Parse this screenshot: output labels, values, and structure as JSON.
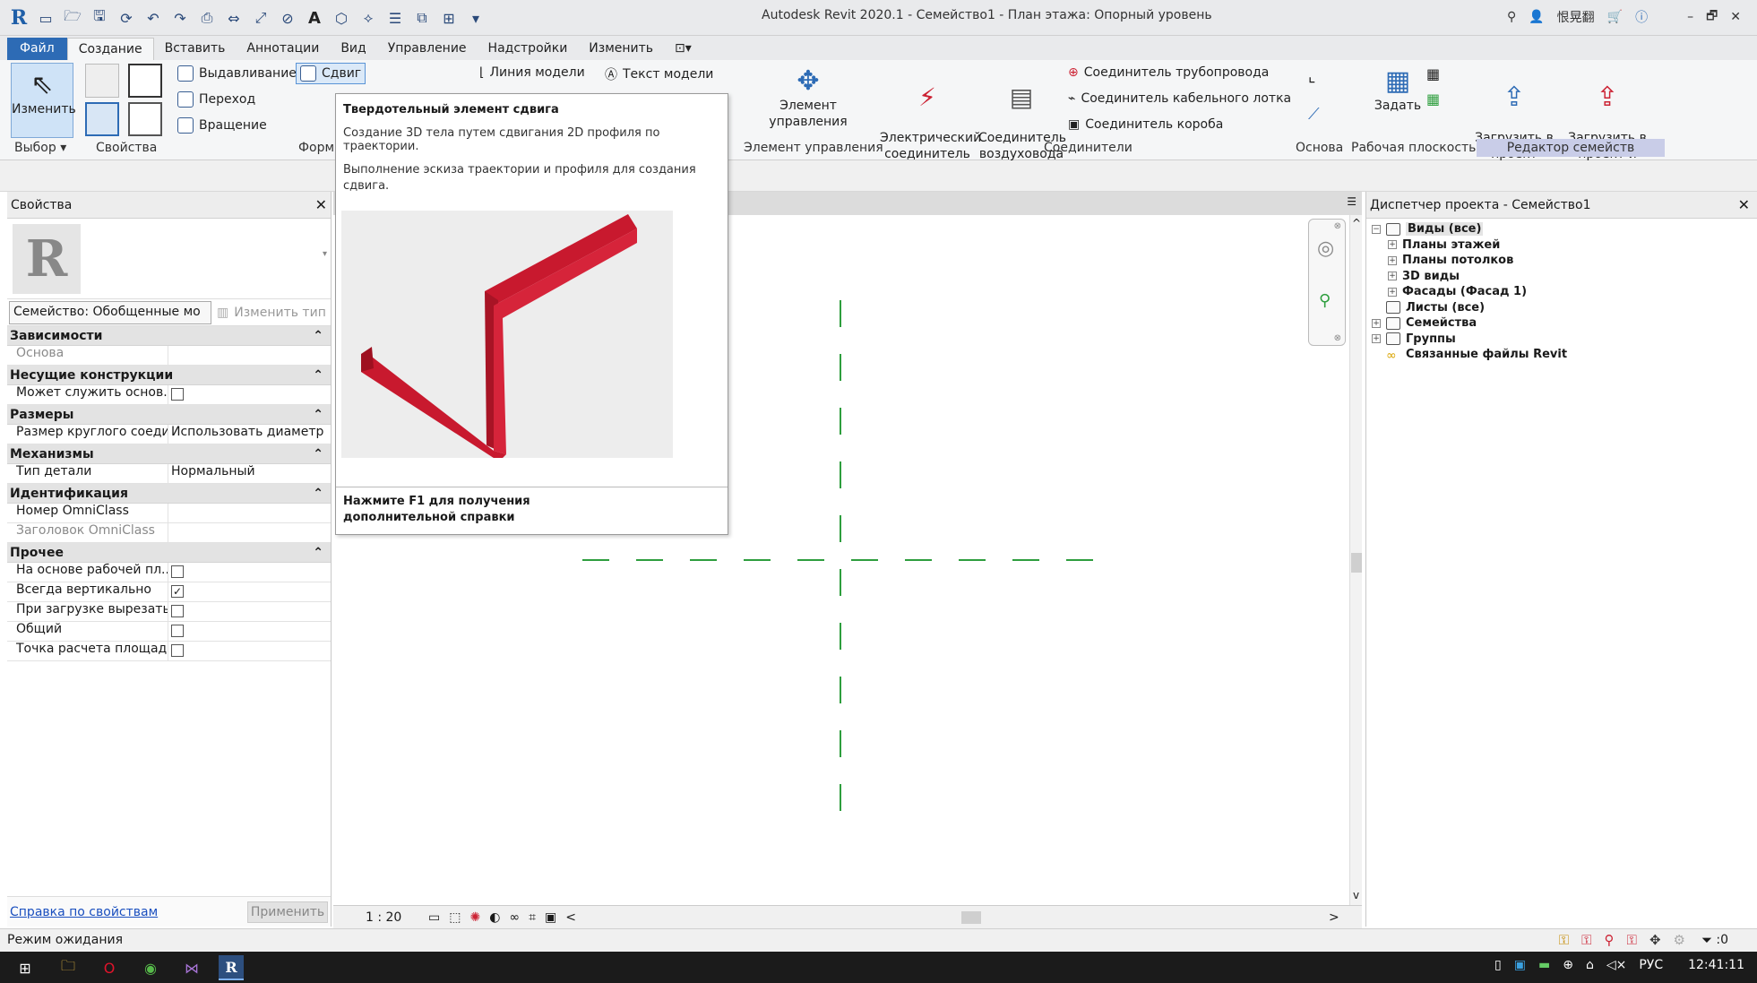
{
  "window": {
    "title": "Autodesk Revit 2020.1 - Семейство1 - План этажа: Опорный уровень",
    "user": "恨晃翻",
    "controls": {
      "minimize": "–",
      "restore": "🗗",
      "close": "✕"
    }
  },
  "tabs": {
    "file": "Файл",
    "items": [
      "Создание",
      "Вставить",
      "Аннотации",
      "Вид",
      "Управление",
      "Надстройки",
      "Изменить"
    ]
  },
  "ribbon": {
    "modify_label": "Изменить",
    "select_panel": "Выбор ▾",
    "properties_panel": "Свойства",
    "forms_panel": "Форм",
    "extrusion": "Выдавливание",
    "sweep": "Сдвиг",
    "blend": "Переход",
    "revolve": "Вращение",
    "model_line": "Линия модели",
    "model_text": "Текст модели",
    "control_element": "Элемент управления",
    "control_panel": "Элемент управления",
    "electrical_connector": "Электрический\nсоединитель",
    "duct_connector": "Соединитель\nвоздуховода",
    "pipe_connector": "Соединитель трубопровода",
    "cable_tray_connector": "Соединитель кабельного лотка",
    "conduit_connector": "Соединитель короба",
    "connectors_panel": "Соединители",
    "datum_panel": "Основа",
    "set": "Задать",
    "workplane_panel": "Рабочая плоскость",
    "load_into_project": "Загрузить в\nпроект",
    "load_and_close": "Загрузить в\nпроект и закрыть",
    "family_editor_panel": "Редактор семейств"
  },
  "tooltip": {
    "title": "Твердотельный элемент сдвига",
    "description": "Создание 3D тела путем сдвигания 2D профиля по траектории.",
    "hint": "Выполнение эскиза траектории и профиля для создания сдвига.",
    "f1": "Нажмите F1 для получения дополнительной справки"
  },
  "properties": {
    "title": "Свойства",
    "type_selector": "Семейство: Обобщенные мо",
    "edit_type": "Изменить тип",
    "groups": [
      {
        "name": "Зависимости",
        "rows": [
          {
            "k": "Основа",
            "v": "",
            "dim": true
          }
        ]
      },
      {
        "name": "Несущие конструкции",
        "rows": [
          {
            "k": "Может служить основ...",
            "v": "",
            "cb": "empty-box"
          }
        ]
      },
      {
        "name": "Размеры",
        "rows": [
          {
            "k": "Размер круглого соеди...",
            "v": "Использовать диаметр"
          }
        ]
      },
      {
        "name": "Механизмы",
        "rows": [
          {
            "k": "Тип детали",
            "v": "Нормальный"
          }
        ]
      },
      {
        "name": "Идентификация",
        "rows": [
          {
            "k": "Номер OmniClass",
            "v": ""
          },
          {
            "k": "Заголовок OmniClass",
            "v": "",
            "dim": true
          }
        ]
      },
      {
        "name": "Прочее",
        "rows": [
          {
            "k": "На основе рабочей пл...",
            "v": "",
            "cb": "empty-box"
          },
          {
            "k": "Всегда вертикально",
            "v": "",
            "cb": "checked-box"
          },
          {
            "k": "При загрузке вырезать...",
            "v": "",
            "cb": "empty-box"
          },
          {
            "k": "Общий",
            "v": "",
            "cb": "empty-box"
          },
          {
            "k": "Точка расчета площади",
            "v": "",
            "cb": "empty-box"
          }
        ]
      }
    ],
    "help_link": "Справка по свойствам",
    "apply": "Применить"
  },
  "view": {
    "scale": "1 : 20",
    "scroll_left": "<",
    "scroll_right": ">",
    "scroll_up": "^",
    "scroll_down": "v"
  },
  "browser": {
    "title": "Диспетчер проекта - Семейство1",
    "nodes": [
      {
        "label": "Виды (все)",
        "toggle": "−",
        "level": 0
      },
      {
        "label": "Планы этажей",
        "toggle": "+",
        "level": 1
      },
      {
        "label": "Планы потолков",
        "toggle": "+",
        "level": 1
      },
      {
        "label": "3D виды",
        "toggle": "+",
        "level": 1
      },
      {
        "label": "Фасады (Фасад 1)",
        "toggle": "+",
        "level": 1
      },
      {
        "label": "Листы (все)",
        "toggle": "",
        "level": 0
      },
      {
        "label": "Семейства",
        "toggle": "+",
        "level": 0
      },
      {
        "label": "Группы",
        "toggle": "+",
        "level": 0
      },
      {
        "label": "Связанные файлы Revit",
        "toggle": "",
        "level": 0
      }
    ]
  },
  "status": {
    "text": "Режим ожидания",
    "filter_count": ":0"
  },
  "taskbar": {
    "language": "РУС",
    "time": "12:41:11"
  },
  "colors": {
    "accent": "#2d6bb5",
    "sweep_shape": "#c8192e",
    "reference_line": "#2e9e3e",
    "family_editor_panel": "#c9cde8"
  }
}
